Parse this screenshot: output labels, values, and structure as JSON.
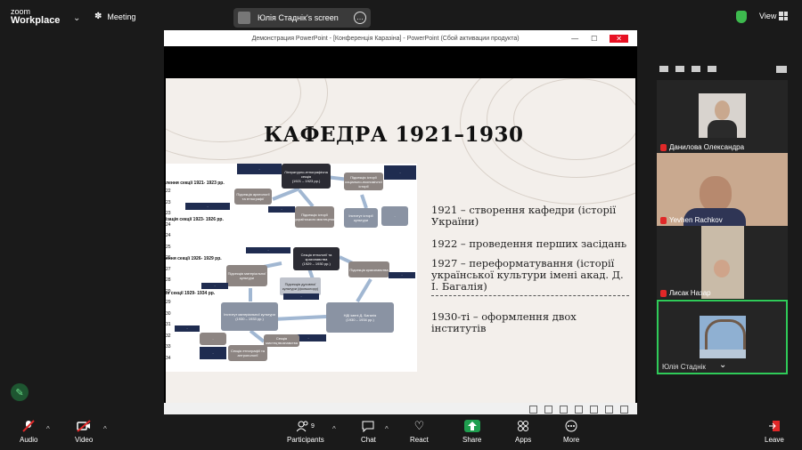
{
  "app": {
    "logo_line1": "zoom",
    "logo_line2": "Workplace",
    "meeting_label": "Meeting"
  },
  "share": {
    "screen_label": "Юлія Стаднік's screen"
  },
  "topbar": {
    "view_label": "View"
  },
  "ppt": {
    "window_title": "Демонстрация PowerPoint - [Конференція  Каразіна] - PowerPoint (Сбой активации продукта)",
    "slide": {
      "title": "КАФЕДРА 1921–1930",
      "bullets": [
        "1921 – створення кафедри (історії України)",
        "1922 – проведення перших засідань",
        "1927 – переформатування (історії української культури імені акад. Д. І. Багалія)",
        "1930-ті – оформлення двох інститутів"
      ],
      "diagram": {
        "left_labels": [
          "лення секції 1921- 1923 рр.",
          "ізація секції 1923- 1926 рр.",
          "ення секції 1926- 1929 рр.",
          "ія секції 1929- 1934 рр."
        ],
        "row_numbers": [
          "22",
          "23",
          "23",
          "24",
          "24",
          "25",
          "26",
          "27",
          "28",
          "29",
          "29",
          "30",
          "31",
          "32",
          "33",
          "34"
        ],
        "box_lit": "Літературно-етнографічна секція",
        "box_lit_years": "(1921 – 1923 рр.)",
        "box_ethno": "Підсекція археології та етнографії",
        "box_hist": "Підсекція історії українського мистецтва",
        "box_soc": "Підсекція історії соціально-економічної історії",
        "box_inst": "Інститут історії культури",
        "box_ethnic": "Секція етнології та краєзнавства",
        "box_ethnic_years": "(1929 – 1930 рр.)",
        "box_material": "Підсекція матеріальної культури",
        "box_kraj": "Підсекція краєзнавства",
        "box_spiritual": "Підсекція духовної культури (фольклору)",
        "box_inst_mat": "Інститут матеріальної культури",
        "box_inst_mat_years": "(1930 – 1933 рр.)",
        "box_ndi": "НДІ імені Д. Багалія",
        "box_ndi_years": "(1930 – 1934 рр.)",
        "box_art": "Секція мистецтвознавства",
        "box_ethno2": "Секція етнографії та антропології"
      }
    }
  },
  "participants": [
    {
      "name": "Данилова Олександра",
      "muted": true
    },
    {
      "name": "Yevhen Rachkov",
      "muted": true
    },
    {
      "name": "Лисак Назар",
      "muted": true
    },
    {
      "name": "Юлія Стаднік",
      "muted": false
    }
  ],
  "toolbar": {
    "audio": "Audio",
    "video": "Video",
    "participants": "Participants",
    "participants_count": "9",
    "chat": "Chat",
    "react": "React",
    "share": "Share",
    "apps": "Apps",
    "more": "More",
    "leave": "Leave"
  },
  "colors": {
    "accent_green": "#3dba4e",
    "share_green": "#1f9e4f",
    "leave_red": "#e02828",
    "active_border": "#2fcb59"
  }
}
